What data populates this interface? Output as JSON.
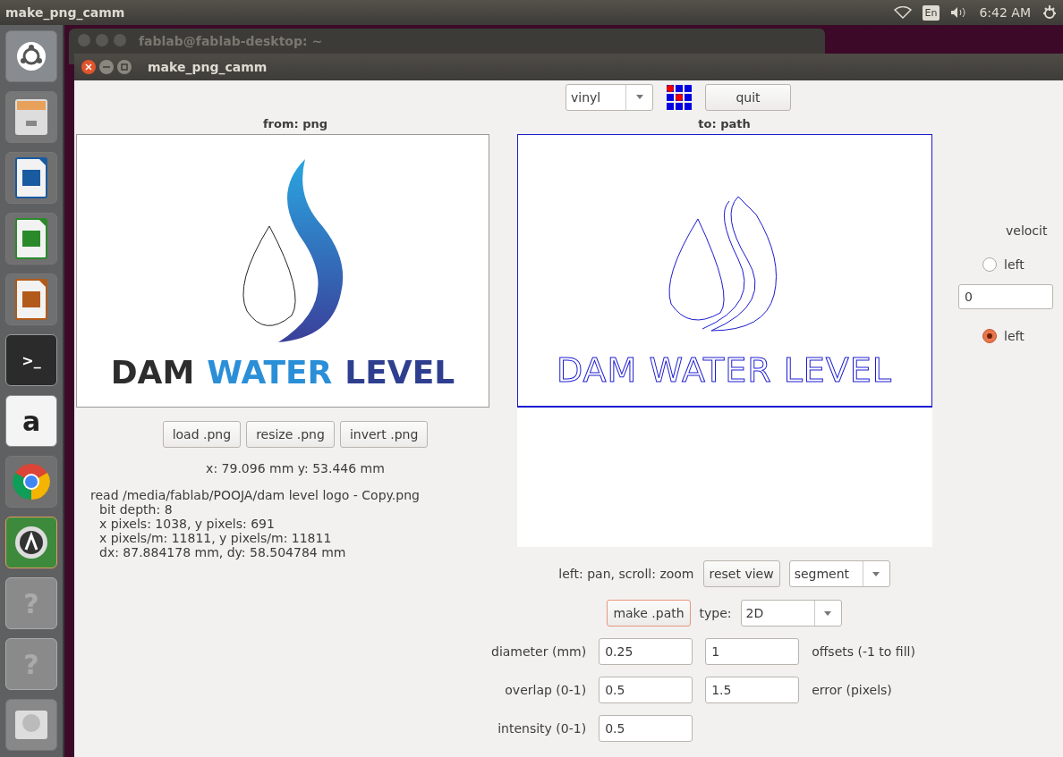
{
  "top_bar": {
    "app_title": "make_png_camm",
    "keyboard": "En",
    "time": "6:42 AM"
  },
  "launcher": [
    {
      "kind": "ubuntu"
    },
    {
      "kind": "files"
    },
    {
      "kind": "writer"
    },
    {
      "kind": "calc"
    },
    {
      "kind": "impress"
    },
    {
      "kind": "terminal",
      "glyph": ">_"
    },
    {
      "kind": "amazon",
      "glyph": "a"
    },
    {
      "kind": "chrome"
    },
    {
      "kind": "updater"
    },
    {
      "kind": "unknown",
      "glyph": "?"
    },
    {
      "kind": "unknown",
      "glyph": "?"
    },
    {
      "kind": "drive"
    }
  ],
  "background_window": {
    "title": "fablab@fablab-desktop: ~"
  },
  "window": {
    "title": "make_png_camm"
  },
  "toolbar": {
    "machine": "vinyl",
    "quit": "quit"
  },
  "input_panel": {
    "heading": "from: png",
    "logo_words": [
      {
        "text": "DAM",
        "color": "#2d2d2d"
      },
      {
        "text": "WATER",
        "color": "#2b8fd8"
      },
      {
        "text": "LEVEL",
        "color": "#2f3f8f"
      }
    ],
    "buttons": [
      "load .png",
      "resize .png",
      "invert .png"
    ],
    "size": "x: 79.096 mm  y: 53.446 mm",
    "info": [
      "read /media/fablab/POOJA/dam level logo - Copy.png",
      "bit depth: 8",
      "x pixels: 1038, y pixels: 691",
      "x pixels/m: 11811, y pixels/m: 11811",
      "dx: 87.884178 mm, dy: 58.504784 mm"
    ]
  },
  "output_panel": {
    "heading": "to: path",
    "path_text": "DAM WATER LEVEL",
    "view_hint": "left: pan, scroll: zoom",
    "reset": "reset view",
    "display": "segment",
    "make_path": "make .path",
    "type_label": "type:",
    "type": "2D",
    "params": [
      {
        "label": "diameter (mm)",
        "value": "0.25",
        "value2": "1",
        "label2": "offsets (-1 to fill)"
      },
      {
        "label": "overlap (0-1)",
        "value": "0.5",
        "value2": "1.5",
        "label2": "error (pixels)"
      },
      {
        "label": "intensity (0-1)",
        "value": "0.5"
      }
    ]
  },
  "machine_panel": {
    "velocity_label": "velocit",
    "items": [
      {
        "kind": "radio",
        "label": "left",
        "selected": false
      },
      {
        "kind": "field",
        "value": "0"
      },
      {
        "kind": "radio",
        "label": "left",
        "selected": true
      }
    ]
  }
}
